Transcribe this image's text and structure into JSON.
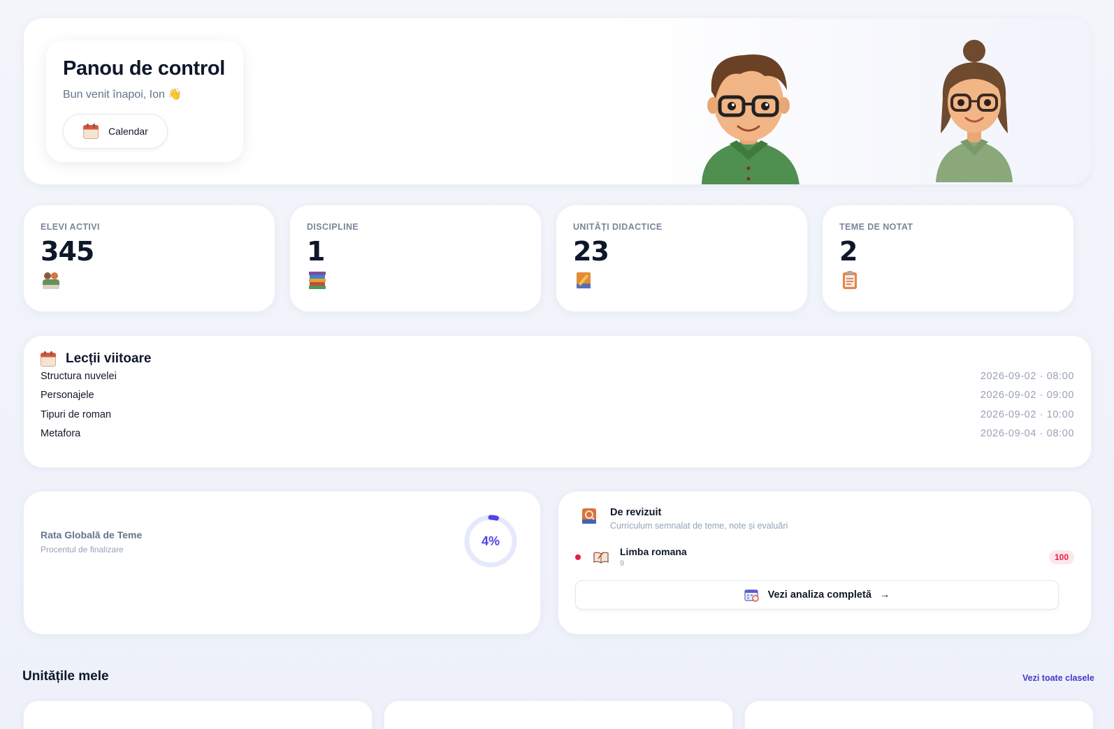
{
  "hero": {
    "title": "Panou de control",
    "subtitle": "Bun venit înapoi, Ion 👋",
    "calendar_button": "Calendar",
    "calendar_icon": "calendar-icon",
    "avatars": [
      "teacher-man-avatar",
      "teacher-woman-avatar"
    ]
  },
  "stats": [
    {
      "label": "ELEVI ACTIVI",
      "value": "345",
      "icon": "students-icon"
    },
    {
      "label": "DISCIPLINE",
      "value": "1",
      "icon": "books-stack-icon"
    },
    {
      "label": "UNITĂȚI DIDACTICE",
      "value": "23",
      "icon": "book-pencil-icon"
    },
    {
      "label": "TEME DE NOTAT",
      "value": "2",
      "icon": "clipboard-icon"
    }
  ],
  "lessons": {
    "title": "Lecții viitoare",
    "items": [
      {
        "name": "Structura nuvelei",
        "time": "2026-09-02 · 08:00"
      },
      {
        "name": "Personajele",
        "time": "2026-09-02 · 09:00"
      },
      {
        "name": "Tipuri de roman",
        "time": "2026-09-02 · 10:00"
      },
      {
        "name": "Metafora",
        "time": "2026-09-04 · 08:00"
      }
    ]
  },
  "rate": {
    "title": "Rata Globală de Teme",
    "subtitle": "Procentul de finalizare",
    "percent_label": "4%",
    "percent_value": 4
  },
  "review": {
    "title": "De revizuit",
    "subtitle": "Curriculum semnalat de teme, note și evaluări",
    "item_name": "Limba romana",
    "item_meta": "9",
    "item_badge": "100",
    "button_label": "Vezi analiza completă",
    "button_arrow": "→"
  },
  "units": {
    "title": "Unitățile mele",
    "link": "Vezi toate clasele"
  },
  "colors": {
    "accent": "#4f46e5",
    "badge_red": "#e11d48",
    "ring_track": "#e6e9fb"
  }
}
